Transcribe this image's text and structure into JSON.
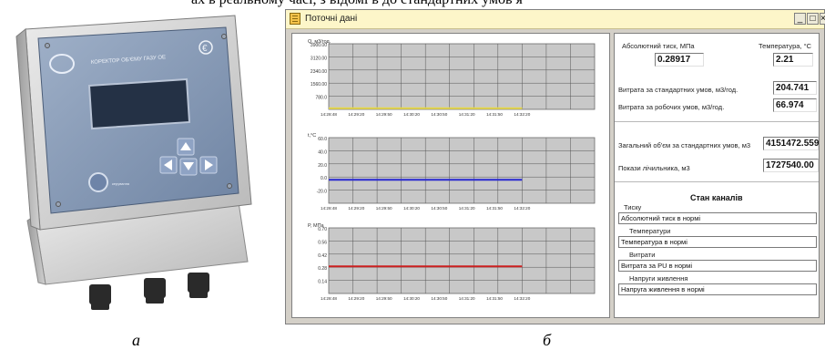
{
  "caption_top": "ах в реальному часі, з відомі в до стандартних умов я",
  "window": {
    "title": "Поточні дані",
    "buttons": {
      "minimize": "_",
      "maximize": "□",
      "close": "×"
    }
  },
  "device": {
    "brand_text": "КОРЕКТОР ОБ'ЄМУ ГАЗУ ОЕ",
    "small_label": "керування",
    "sign": "€"
  },
  "charts": {
    "time_ticks": [
      "14:28:48",
      "14:29:20",
      "14:29:50",
      "14:30:20",
      "14:30:50",
      "14:31:20",
      "14:31:50",
      "14:32:20"
    ],
    "cols": 11,
    "rows": 5,
    "panels": [
      {
        "ylabel": "Q, м3/год.",
        "yticks": [
          "3900.00",
          "3120.00",
          "2340.00",
          "1560.00",
          "780.0"
        ],
        "line_color": "#e6d84a"
      },
      {
        "ylabel": "t,°C",
        "yticks": [
          "60.0",
          "40.0",
          "20.0",
          "0.0",
          "-20.0"
        ],
        "line_color": "#2828d0"
      },
      {
        "ylabel": "P, МПа",
        "yticks": [
          "0.70",
          "0.56",
          "0.42",
          "0.28",
          "0.14"
        ],
        "line_color": "#cc2020"
      }
    ]
  },
  "chart_data": [
    {
      "type": "line",
      "ylabel": "Q, м3/год.",
      "x": [
        "14:28:48",
        "14:29:20",
        "14:29:50",
        "14:30:20",
        "14:30:50",
        "14:31:20",
        "14:31:50",
        "14:32:20"
      ],
      "ylim": [
        0,
        3900
      ],
      "series": [
        {
          "values": [
            66.97,
            66.97,
            66.97,
            66.97,
            66.97,
            66.97,
            66.97,
            66.97
          ]
        }
      ]
    },
    {
      "type": "line",
      "ylabel": "t,°C",
      "x": [
        "14:28:48",
        "14:29:20",
        "14:29:50",
        "14:30:20",
        "14:30:50",
        "14:31:20",
        "14:31:50",
        "14:32:20"
      ],
      "ylim": [
        -30,
        60
      ],
      "series": [
        {
          "values": [
            2.21,
            2.21,
            2.21,
            2.21,
            2.21,
            2.21,
            2.21,
            2.21
          ]
        }
      ]
    },
    {
      "type": "line",
      "ylabel": "P, МПа",
      "x": [
        "14:28:48",
        "14:29:20",
        "14:29:50",
        "14:30:20",
        "14:30:50",
        "14:31:20",
        "14:31:50",
        "14:32:20"
      ],
      "ylim": [
        0,
        0.7
      ],
      "series": [
        {
          "values": [
            0.28917,
            0.28917,
            0.28917,
            0.28917,
            0.28917,
            0.28917,
            0.28917,
            0.28917
          ]
        }
      ]
    }
  ],
  "readings": {
    "abs_pressure_label": "Абсолютний тиск, МПа",
    "abs_pressure_value": "0.28917",
    "temperature_label": "Температура, °С",
    "temperature_value": "2.21",
    "flow_std_label": "Витрата за стандартних умов, м3/год.",
    "flow_std_value": "204.741",
    "flow_work_label": "Витрата за робочих умов, м3/год.",
    "flow_work_value": "66.974",
    "total_volume_label": "Загальний об'єм за стандартних умов, м3",
    "total_volume_value": "4151472.559",
    "counter_label": "Покази лічильника, м3",
    "counter_value": "1727540.00"
  },
  "channels": {
    "title": "Стан каналів",
    "items": [
      {
        "label": "Тиску",
        "status": "Абсолютний тиск в нормі"
      },
      {
        "label": "Температури",
        "status": "Температура в нормі"
      },
      {
        "label": "Витрати",
        "status": "Витрата за РU в нормі"
      },
      {
        "label": "Напруги живлення",
        "status": "Напруга живлення в нормі"
      }
    ]
  },
  "subcaptions": {
    "a": "а",
    "b": "б"
  }
}
